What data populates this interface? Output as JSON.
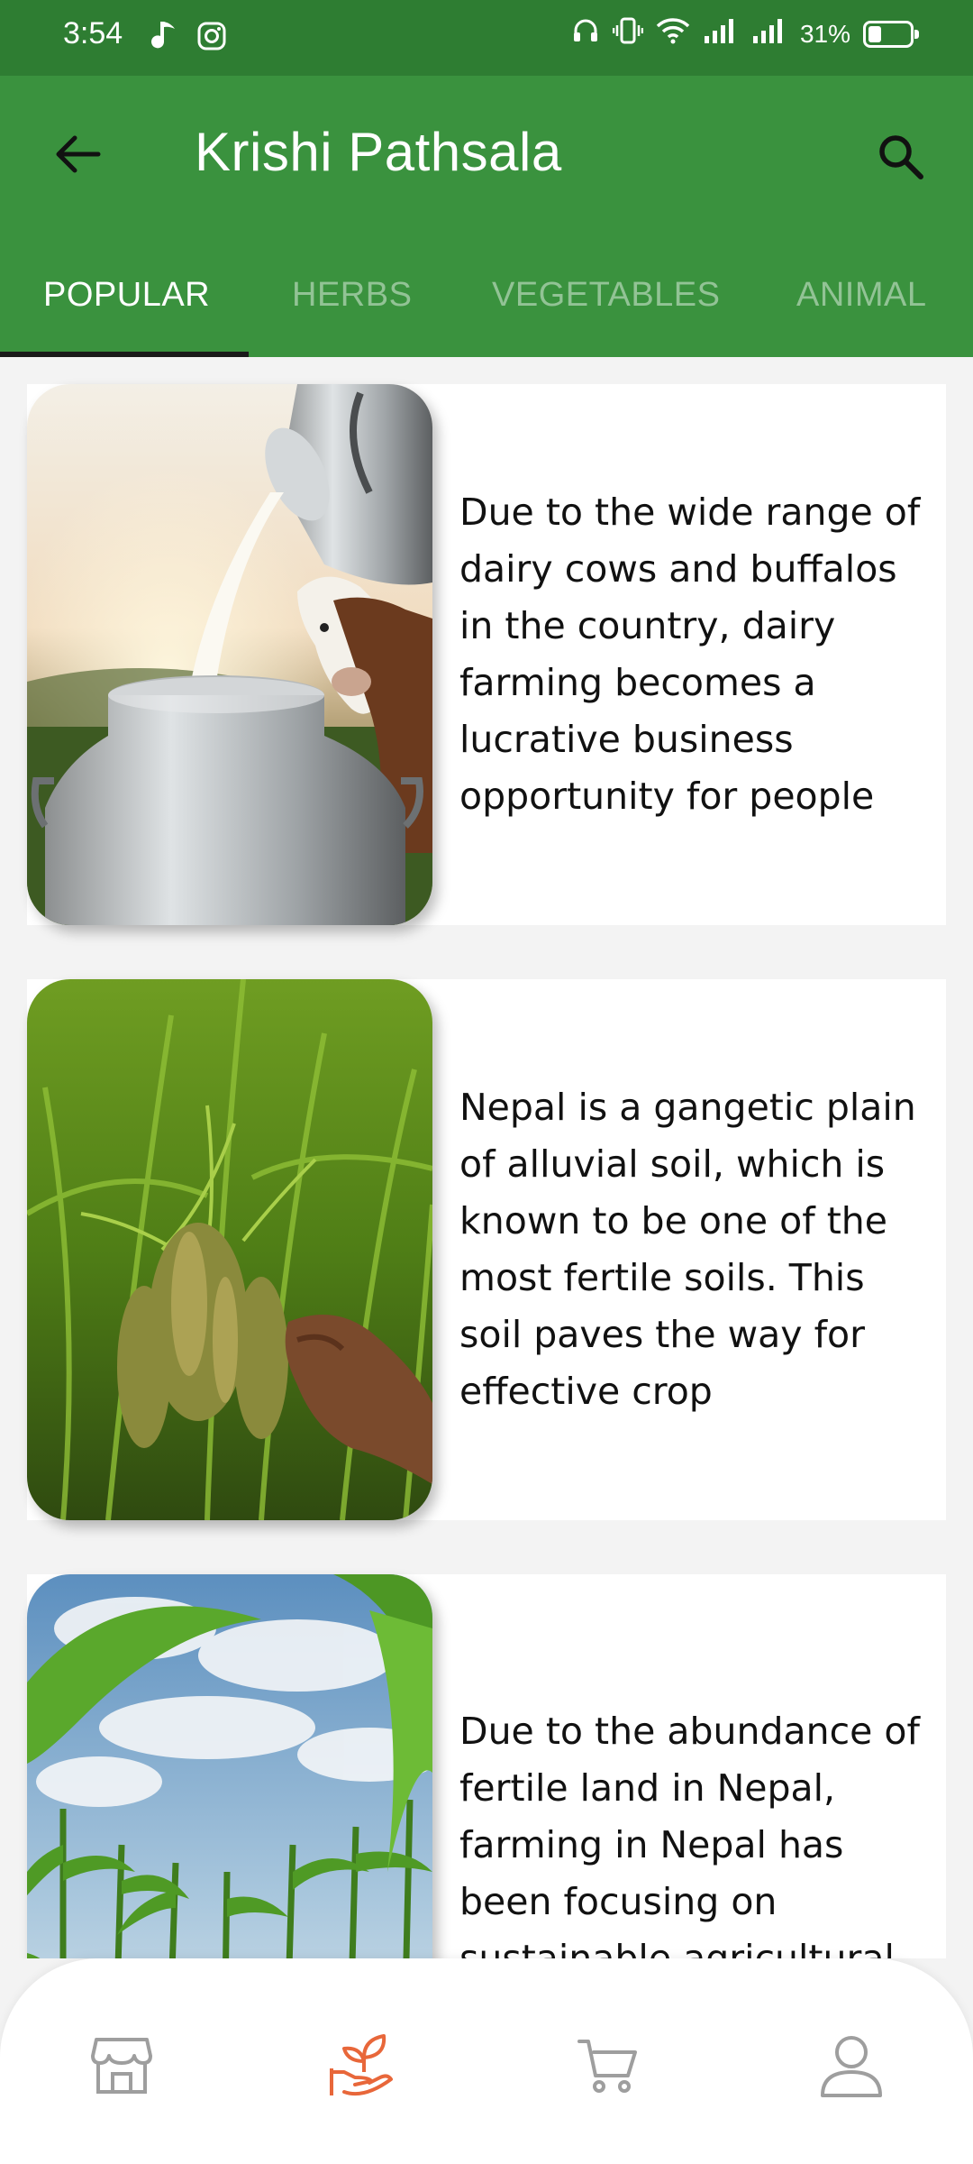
{
  "status_bar": {
    "time": "3:54",
    "battery": "31%",
    "battery_level": 0.31,
    "icons": [
      "music-note-icon",
      "instagram-icon",
      "headset-icon",
      "vibrate-icon",
      "wifi-icon",
      "signal-icon",
      "signal-icon",
      "battery-icon"
    ]
  },
  "app_bar": {
    "title": "Krishi Pathsala",
    "back_icon": "back-arrow-icon",
    "search_icon": "search-icon"
  },
  "tabs": [
    {
      "label": "POPULAR",
      "active": true
    },
    {
      "label": "HERBS",
      "active": false
    },
    {
      "label": "VEGETABLES",
      "active": false
    },
    {
      "label": "ANIMAL",
      "active": false
    }
  ],
  "cards": [
    {
      "image": "milk-can-dairy-cow-image",
      "text": "Due to the wide range of dairy cows and buffalos in the country, dairy farming becomes a lucrative business opportunity for people"
    },
    {
      "image": "rice-paddy-hand-image",
      "text": "Nepal is a gangetic plain of alluvial soil, which is known to be one of the most fertile soils. This soil paves the way for effective crop"
    },
    {
      "image": "corn-field-sky-image",
      "text": "Due to the abundance of fertile land in Nepal, farming in Nepal has been focusing on sustainable agricultural"
    }
  ],
  "bottom_nav": [
    {
      "icon": "store-icon",
      "active": false
    },
    {
      "icon": "plant-hand-icon",
      "active": true
    },
    {
      "icon": "cart-icon",
      "active": false
    },
    {
      "icon": "profile-icon",
      "active": false
    }
  ],
  "colors": {
    "status_bar": "#2e7d32",
    "app_bar": "#3a923e",
    "active_nav": "#e8673a",
    "inactive_nav": "#9e9e9e"
  }
}
